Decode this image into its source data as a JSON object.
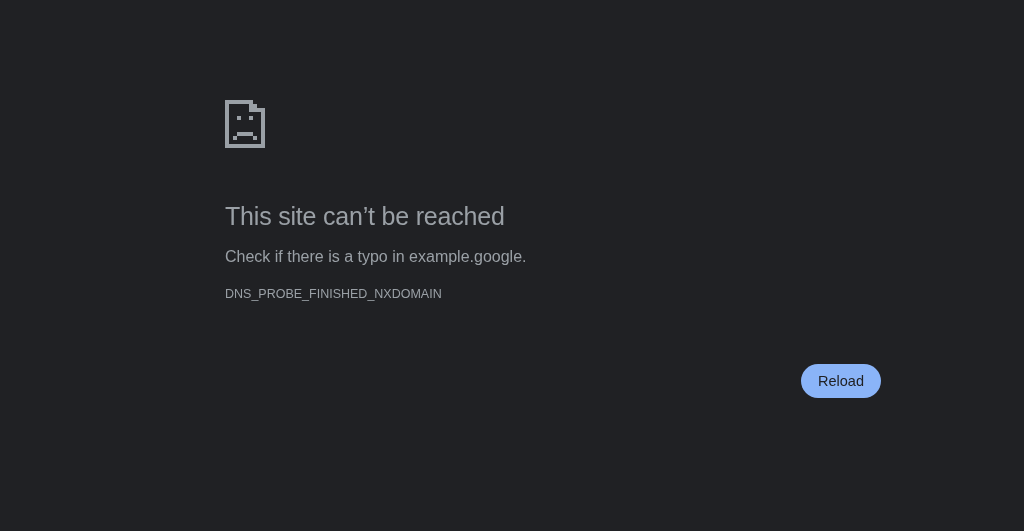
{
  "title": "This site can’t be reached",
  "message": "Check if there is a typo in example.google.",
  "error_code": "DNS_PROBE_FINISHED_NXDOMAIN",
  "buttons": [
    "Reload"
  ]
}
